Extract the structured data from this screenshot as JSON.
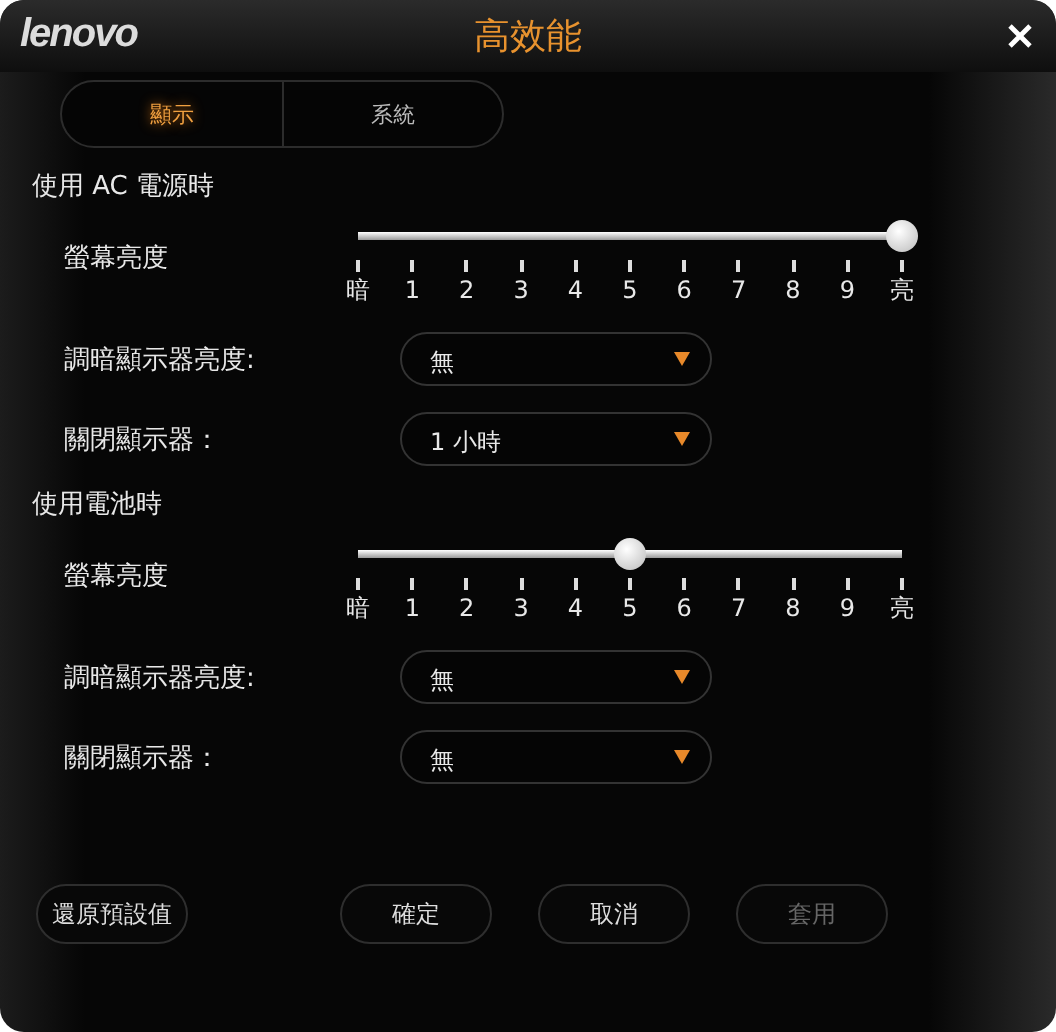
{
  "window": {
    "logo": "lenovo",
    "title": "高效能"
  },
  "tabs": [
    {
      "label": "顯示",
      "selected": true
    },
    {
      "label": "系統",
      "selected": false
    }
  ],
  "sections": [
    {
      "title": "使用 AC 電源時",
      "brightness": {
        "label": "螢幕亮度",
        "level": 1.0,
        "ticks": [
          "暗",
          "1",
          "2",
          "3",
          "4",
          "5",
          "6",
          "7",
          "8",
          "9",
          "亮"
        ]
      },
      "settings": [
        {
          "label": "調暗顯示器亮度:",
          "value": "無"
        },
        {
          "label": "關閉顯示器：",
          "value": "1 小時"
        }
      ]
    },
    {
      "title": "使用電池時",
      "brightness": {
        "label": "螢幕亮度",
        "level": 0.5,
        "ticks": [
          "暗",
          "1",
          "2",
          "3",
          "4",
          "5",
          "6",
          "7",
          "8",
          "9",
          "亮"
        ]
      },
      "settings": [
        {
          "label": "調暗顯示器亮度:",
          "value": "無"
        },
        {
          "label": "關閉顯示器：",
          "value": "無"
        }
      ]
    }
  ],
  "buttons": [
    {
      "label": "還原預設值",
      "disabled": false
    },
    {
      "label": "確定",
      "disabled": false
    },
    {
      "label": "取消",
      "disabled": false
    },
    {
      "label": "套用",
      "disabled": true
    }
  ]
}
